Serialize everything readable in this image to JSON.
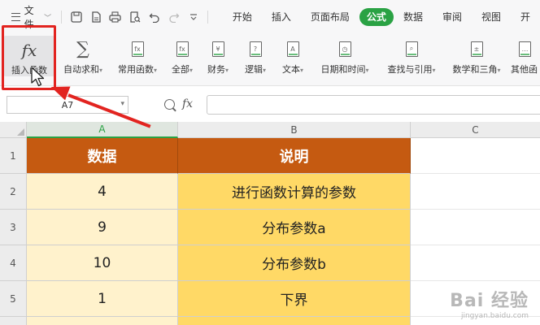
{
  "menubar": {
    "file_label": "文件",
    "tabs": [
      "开始",
      "插入",
      "页面布局",
      "公式",
      "数据",
      "审阅",
      "视图",
      "开"
    ]
  },
  "ribbon": {
    "insert_function": "插入函数",
    "autosum": "自动求和",
    "common": "常用函数",
    "all": "全部",
    "finance": "财务",
    "logic": "逻辑",
    "text": "文本",
    "datetime": "日期和时间",
    "lookup": "查找与引用",
    "math": "数学和三角",
    "other": "其他函"
  },
  "formulabar": {
    "name_box": "A7",
    "fx": "fx",
    "formula": ""
  },
  "sheet": {
    "columns": [
      "A",
      "B",
      "C"
    ],
    "rows": [
      "1",
      "2",
      "3",
      "4",
      "5"
    ],
    "header": [
      "数据",
      "说明"
    ],
    "data": [
      [
        "4",
        "进行函数计算的参数"
      ],
      [
        "9",
        "分布参数a"
      ],
      [
        "10",
        "分布参数b"
      ],
      [
        "1",
        "下界"
      ]
    ]
  },
  "colors": {
    "accent": "#2aa244",
    "header_fill": "#c55a11",
    "col_a_fill": "#fff2cc",
    "col_b_fill": "#ffd966",
    "annotation": "#e22420"
  },
  "watermark": {
    "main": "Bai 经验",
    "sub": "jingyan.baidu.com"
  }
}
